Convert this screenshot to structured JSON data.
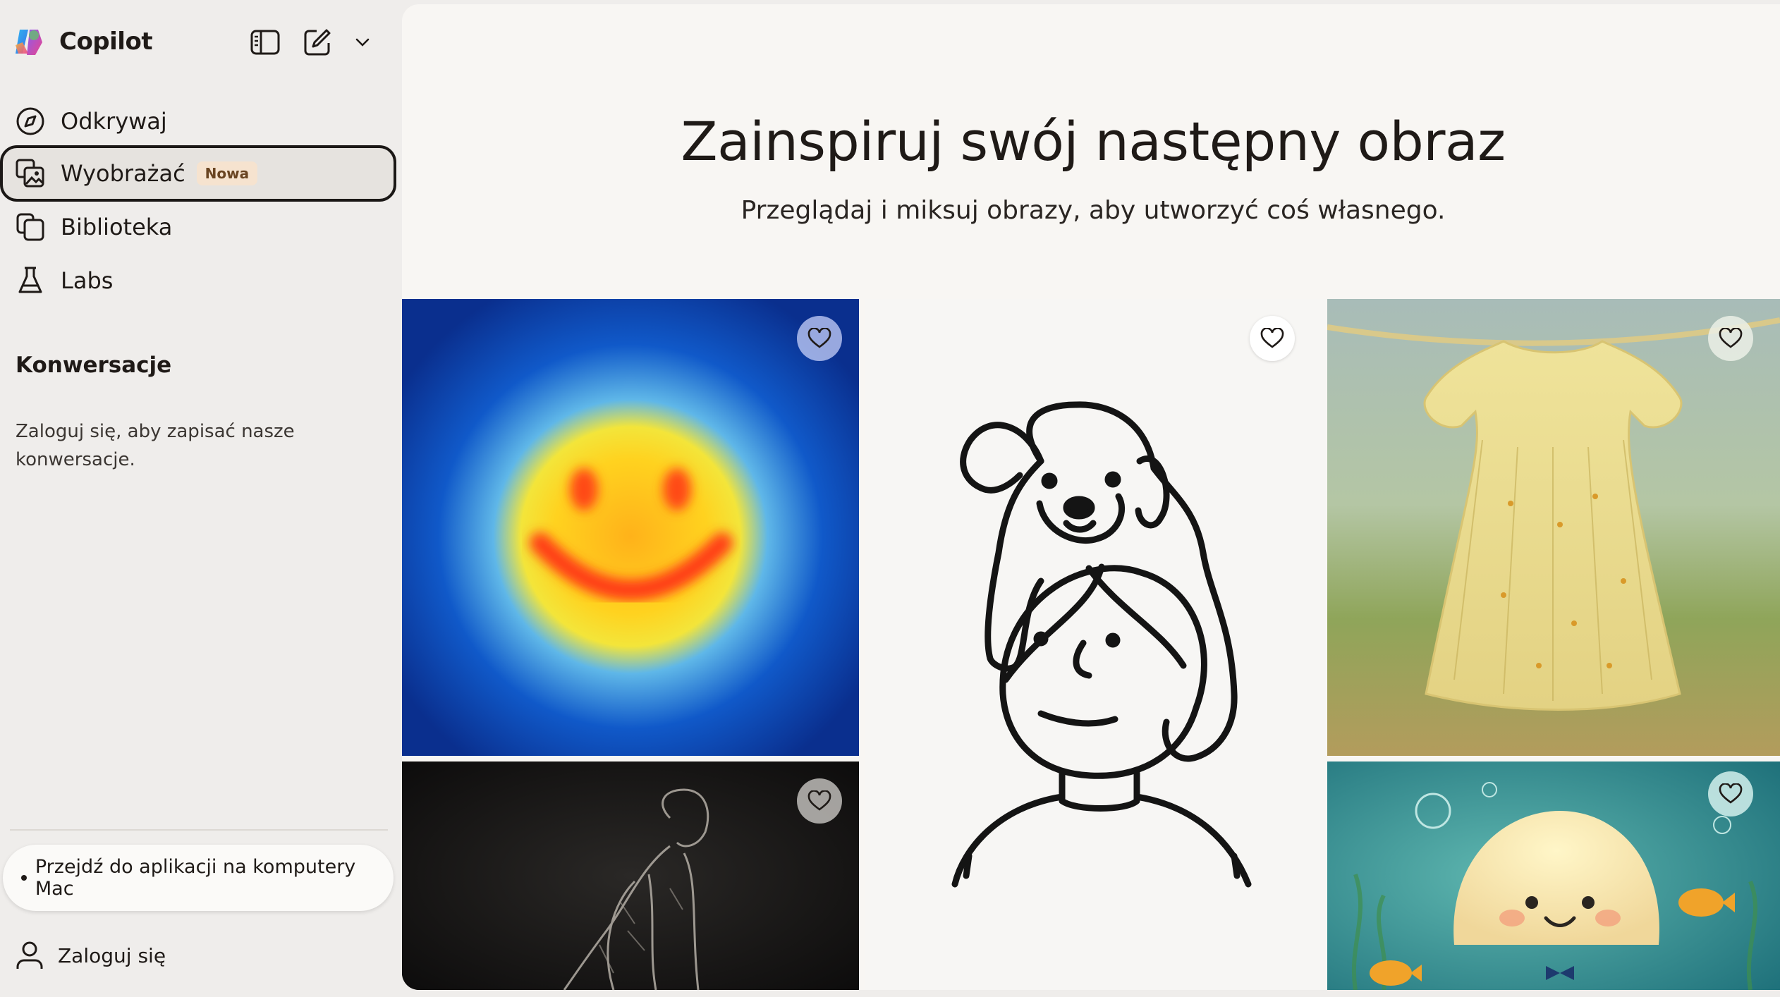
{
  "app": {
    "name": "Copilot"
  },
  "nav": {
    "discover": "Odkrywaj",
    "imagine": "Wyobrażać",
    "imagine_badge": "Nowa",
    "library": "Biblioteka",
    "labs": "Labs"
  },
  "conversations": {
    "title": "Konwersacje",
    "note": "Zaloguj się, aby zapisać nasze konwersacje."
  },
  "footer": {
    "mac_app": "Przejdź do aplikacji na komputery Mac",
    "sign_in": "Zaloguj się"
  },
  "main": {
    "title": "Zainspiruj swój następny obraz",
    "subtitle": "Przeglądaj i miksuj obrazy, aby utworzyć coś własnego."
  },
  "gallery": [
    {
      "name": "smiley-blur",
      "icon": "heart-icon"
    },
    {
      "name": "dog-on-head-drawing",
      "icon": "heart-icon"
    },
    {
      "name": "wool-dress",
      "icon": "heart-icon"
    },
    {
      "name": "charcoal-man",
      "icon": "heart-icon"
    },
    {
      "name": "cute-jellyfish",
      "icon": "heart-icon"
    }
  ],
  "colors": {
    "accent": "#1b1816",
    "badge_bg": "#f6e3cf",
    "sidebar_bg": "#efedeb"
  }
}
